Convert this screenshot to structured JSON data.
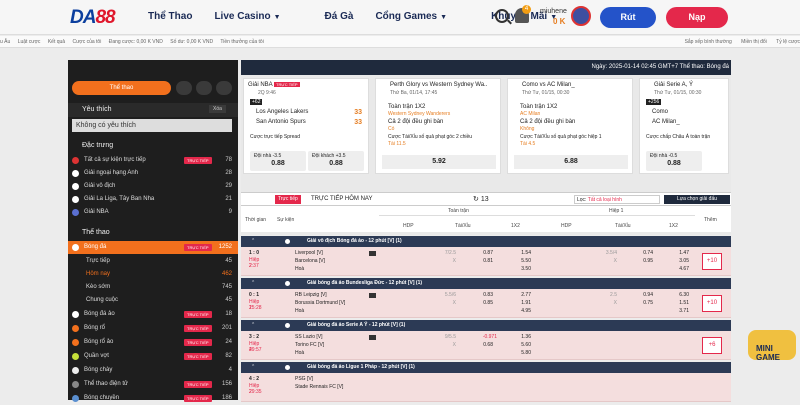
{
  "header": {
    "logo_main": "DA",
    "logo_accent": "88",
    "nav": [
      "Thể Thao",
      "Live Casino",
      "Đá Gà",
      "Cổng Games",
      "Khuyến Mãi"
    ],
    "bell_count": "4",
    "username": "miuhene",
    "balance": "0 K",
    "withdraw": "Rút",
    "deposit": "Nạp"
  },
  "subbar": {
    "left": [
      "u Âu",
      "Luật cược",
      "Kết quả",
      "Cược của tôi",
      "Đang cược: 0,00 K VND",
      "Số dư: 0,00 K VND",
      "Tiền thưởng của tôi"
    ],
    "right": [
      "Sắp xếp bình thường",
      "Miền thị đổi",
      "Tỷ lệ cược"
    ]
  },
  "sidebar": {
    "sport_btn": "Thể thao",
    "fav_title": "Yêu thích",
    "fav_clear": "Xóa",
    "fav_empty": "Không có yêu thích",
    "featured_title": "Đặc trưng",
    "featured": [
      {
        "name": "Tất cả sự kiện trực tiếp",
        "tag": "TRỰC TIẾP",
        "count": "78"
      },
      {
        "name": "Giải ngoại hạng Anh",
        "count": "28"
      },
      {
        "name": "Giải vô địch",
        "count": "29"
      },
      {
        "name": "Giải La Liga, Tây Ban Nha",
        "count": "21"
      },
      {
        "name": "Giải NBA",
        "count": "9"
      }
    ],
    "sports_title": "Thể thao",
    "sports": [
      {
        "name": "Bóng đá",
        "tag": "TRỰC TIẾP",
        "count": "1252"
      },
      {
        "name": "Trực tiếp",
        "count": "45"
      },
      {
        "name": "Hôm nay",
        "count": "462"
      },
      {
        "name": "Kèo sớm",
        "count": "745"
      },
      {
        "name": "Chung cuộc",
        "count": "45"
      },
      {
        "name": "Bóng đá ảo",
        "tag": "TRỰC TIẾP",
        "count": "18"
      },
      {
        "name": "Bóng rổ",
        "tag": "TRỰC TIẾP",
        "count": "201"
      },
      {
        "name": "Bóng rổ ảo",
        "tag": "TRỰC TIẾP",
        "count": "24"
      },
      {
        "name": "Quần vợt",
        "tag": "TRỰC TIẾP",
        "count": "82"
      },
      {
        "name": "Bóng chày",
        "count": "4"
      },
      {
        "name": "Thể thao điện tử",
        "tag": "TRỰC TIẾP",
        "count": "156"
      },
      {
        "name": "Bóng chuyền",
        "tag": "TRỰC TIẾP",
        "count": "186"
      }
    ]
  },
  "datebar": "Ngày: 2025-01-14 02:45 GMT+7 Thể thao: Bóng đá",
  "cards": [
    {
      "league": "Giải NBA",
      "tag": "TRỰC TIẾP",
      "sub": "2Q 9:46",
      "badge": "+62",
      "team1": "Los Angeles Lakers",
      "team2": "San Antonio Spurs",
      "score1": "33",
      "score2": "33",
      "market": "Cược trực tiếp Spread",
      "o1_label": "Đội nhà -3.5",
      "o1": "0.88",
      "o2_label": "Đội khách +3.5",
      "o2": "0.88"
    },
    {
      "league": "Perth Glory vs Western Sydney Wa..",
      "sub": "Thứ Ba, 01/14, 17:45",
      "line1": "Toàn trận 1X2",
      "line2": "Western Sydney Wanderers",
      "line3": "Cả 2 đội đều ghi bàn",
      "line4": "Có",
      "line5": "Cược Tài/Xỉu số quả phạt góc 2 chiều",
      "line6": "Tài 11.5",
      "odd": "5.92"
    },
    {
      "league": "Como vs AC Milan_",
      "sub": "Thứ Tư, 01/15, 00:30",
      "line1": "Toàn trận 1X2",
      "line2": "AC Milan",
      "line3": "Cả 2 đội đều ghi bàn",
      "line4": "Không",
      "line5": "Cược Tài/Xỉu số quả phạt góc hiệp 1",
      "line6": "Tài 4.5",
      "odd": "6.88"
    },
    {
      "league": "Giải Serie A, Ý",
      "sub": "Thứ Tư, 01/15, 00:30",
      "badge": "+256",
      "team1": "Como",
      "team2": "AC Milan_",
      "market": "Cược chấp Châu Á toàn trận",
      "o1_label": "Đội nhà -0.5",
      "o1": "0.88"
    }
  ],
  "toolbar": {
    "live": "Trực tiếp",
    "title": "TRỰC TIẾP HÔM NAY",
    "count": "13",
    "filter_label": "Lọc:",
    "filter_value": "Tất cả loại hình",
    "choose": "Lựa chọn giải đấu"
  },
  "thead": {
    "time": "Thời gian",
    "event": "Sự kiện",
    "full": "Toàn trận",
    "half": "Hiệp 1",
    "hdp": "HDP",
    "ou": "Tài/Xỉu",
    "x12": "1X2",
    "more": "Thêm"
  },
  "leagues": [
    {
      "name": "Giải vô địch Bóng đá ảo - 12 phút [V] (1)",
      "match": {
        "score": "1 : 0",
        "time": "Hiệp 2",
        "clock": "2:37",
        "team1": "Liverpool [V]",
        "team2": "Barcelona [V]",
        "draw": "Hoà",
        "h1": "7/2.5",
        "h2": "X",
        "h3": "0.87",
        "h4": "0.81",
        "x1": "1.54",
        "x2": "5.50",
        "x3": "3.50",
        "i1": "3.5/4",
        "i2": "X",
        "i3": "0.74",
        "i4": "0.95",
        "j1": "1.47",
        "j2": "3.05",
        "j3": "4.67",
        "more": "+10"
      }
    },
    {
      "name": "Giải bóng đá ảo Bundesliga Đức - 12 phút [V] (1)",
      "match": {
        "score": "0 : 1",
        "time": "Hiệp 1",
        "clock": "25:28",
        "team1": "RB Leipzig [V]",
        "team2": "Borussia Dortmund [V]",
        "draw": "Hoà",
        "h1": "5.5/6",
        "h2": "X",
        "h3": "0.83",
        "h4": "0.85",
        "x1": "2.77",
        "x2": "1.91",
        "x3": "4.95",
        "i1": "2.5",
        "i2": "X",
        "i3": "0.94",
        "i4": "0.75",
        "j1": "6.30",
        "j2": "1.51",
        "j3": "3.71",
        "more": "+10"
      }
    },
    {
      "name": "Giải bóng đá ảo Serie A Ý - 12 phút [V] (1)",
      "match": {
        "score": "3 : 2",
        "time": "Hiệp 2",
        "clock": "49:57",
        "team1": "SS Lazio [V]",
        "team2": "Torino FC [V]",
        "draw": "Hoà",
        "h1": "9/5.5",
        "h2": "X",
        "h3": "-0.971",
        "h4": "0.68",
        "x1": "1.36",
        "x2": "5.60",
        "x3": "5.80",
        "more": "+6"
      }
    },
    {
      "name": "Giải bóng đá ảo Ligue 1 Pháp - 12 phút [V] (1)",
      "match": {
        "score": "4 : 2",
        "time": "Hiệp 2",
        "clock": "29:35",
        "team1": "PSG [V]",
        "team2": "Stade Rennais FC [V]"
      }
    }
  ],
  "float_badge": "MINI GAME"
}
